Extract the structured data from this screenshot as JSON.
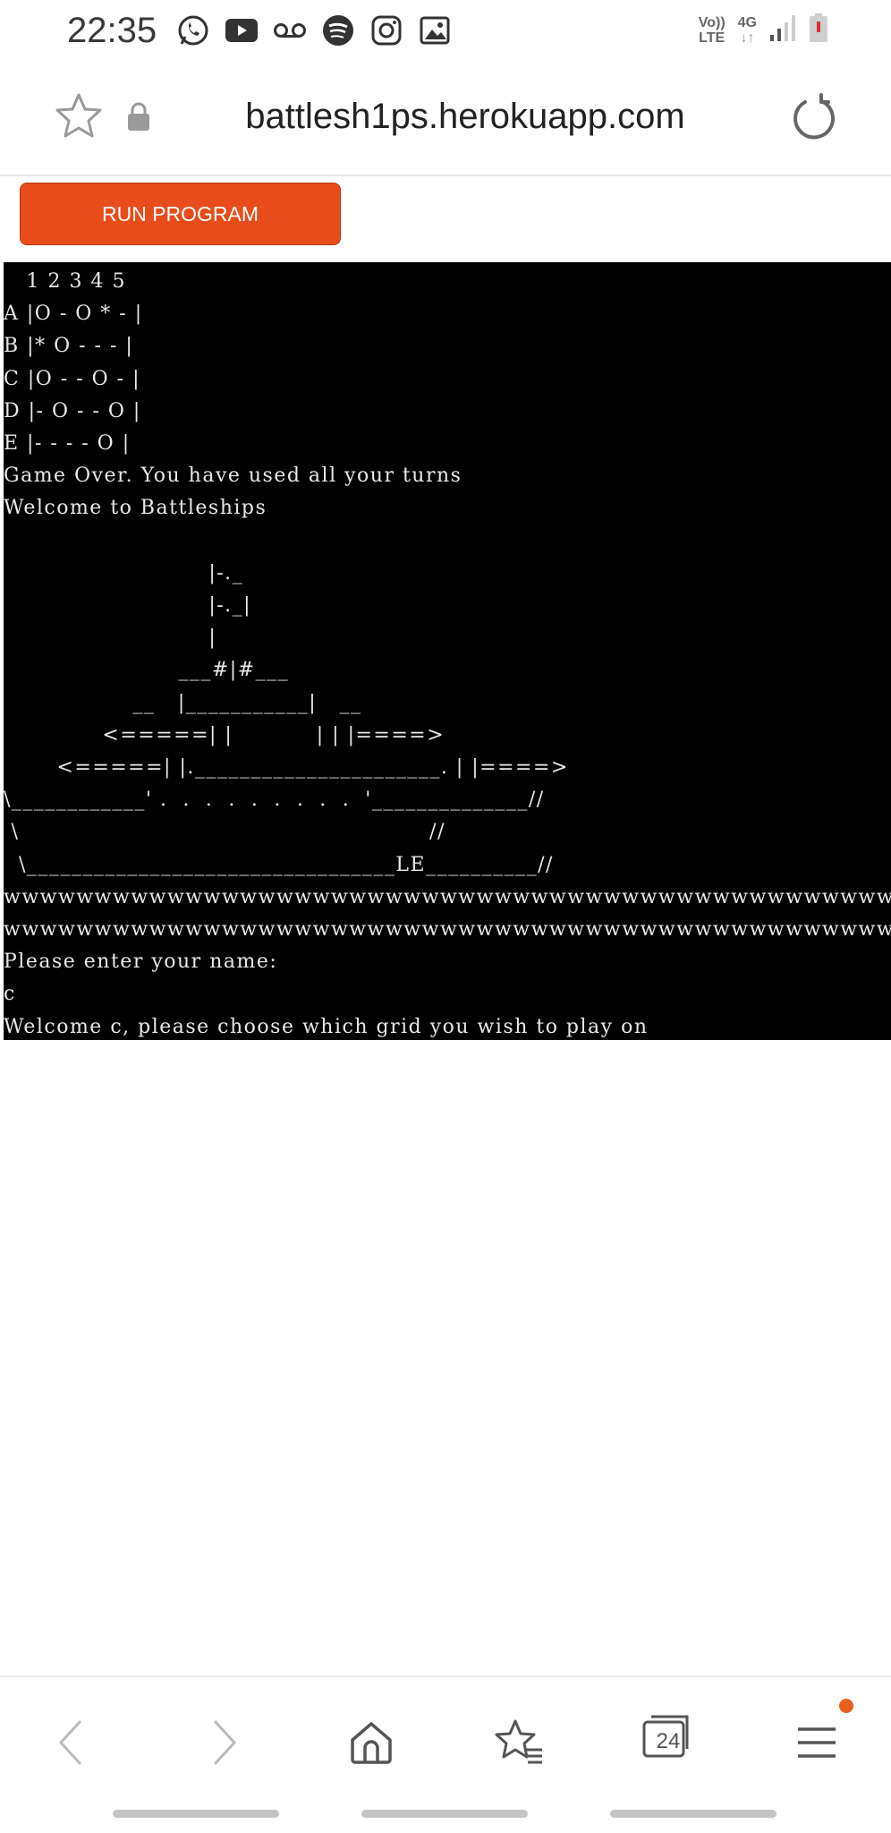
{
  "status_bar": {
    "time": "22:35",
    "icons": [
      "whatsapp-icon",
      "youtube-icon",
      "voicemail-icon",
      "spotify-icon",
      "instagram-icon",
      "gallery-icon"
    ],
    "volte_top": "Vo))",
    "volte_bottom": "LTE",
    "network": "4G"
  },
  "address_bar": {
    "url": "battlesh1ps.herokuapp.com"
  },
  "run_button": {
    "label": "RUN PROGRAM",
    "color": "#e84c1a"
  },
  "terminal": {
    "lines": [
      "   1 2 3 4 5",
      "A |O - O * - |",
      "B |* O - - - |",
      "C |O - - O - |",
      "D |- O - - O |",
      "E |- - - - O |",
      "Game Over. You have used all your turns",
      "Welcome to Battleships",
      "",
      "                           |-._",
      "                           |-._|",
      "                           |",
      "                       ___#|#___",
      "                 __   |___________|   __",
      "             <=====| |           | | |====>",
      "       <=====| |.______________________. | |====>",
      "\\____________' .  .  .  .  .  .  .  .  .  '______________//",
      " \\                                                      //",
      "  \\_________________________________LE__________//",
      "wwwwwwwwwwwwwwwwwwwwwwwwwwwwwwwwwwwwwwwwwwwwwwwwwwwwwwwwwwwwwwwww",
      "wwwwwwwwwwwwwwwwwwwwwwwwwwwwwwwwwwwwwwwwwwwwwwwwwwwwwwwwwwwwwwwww",
      "Please enter your name:",
      "c",
      "Welcome c, please choose which grid you wish to play on"
    ]
  },
  "bottom_nav": {
    "tab_count": "24"
  }
}
